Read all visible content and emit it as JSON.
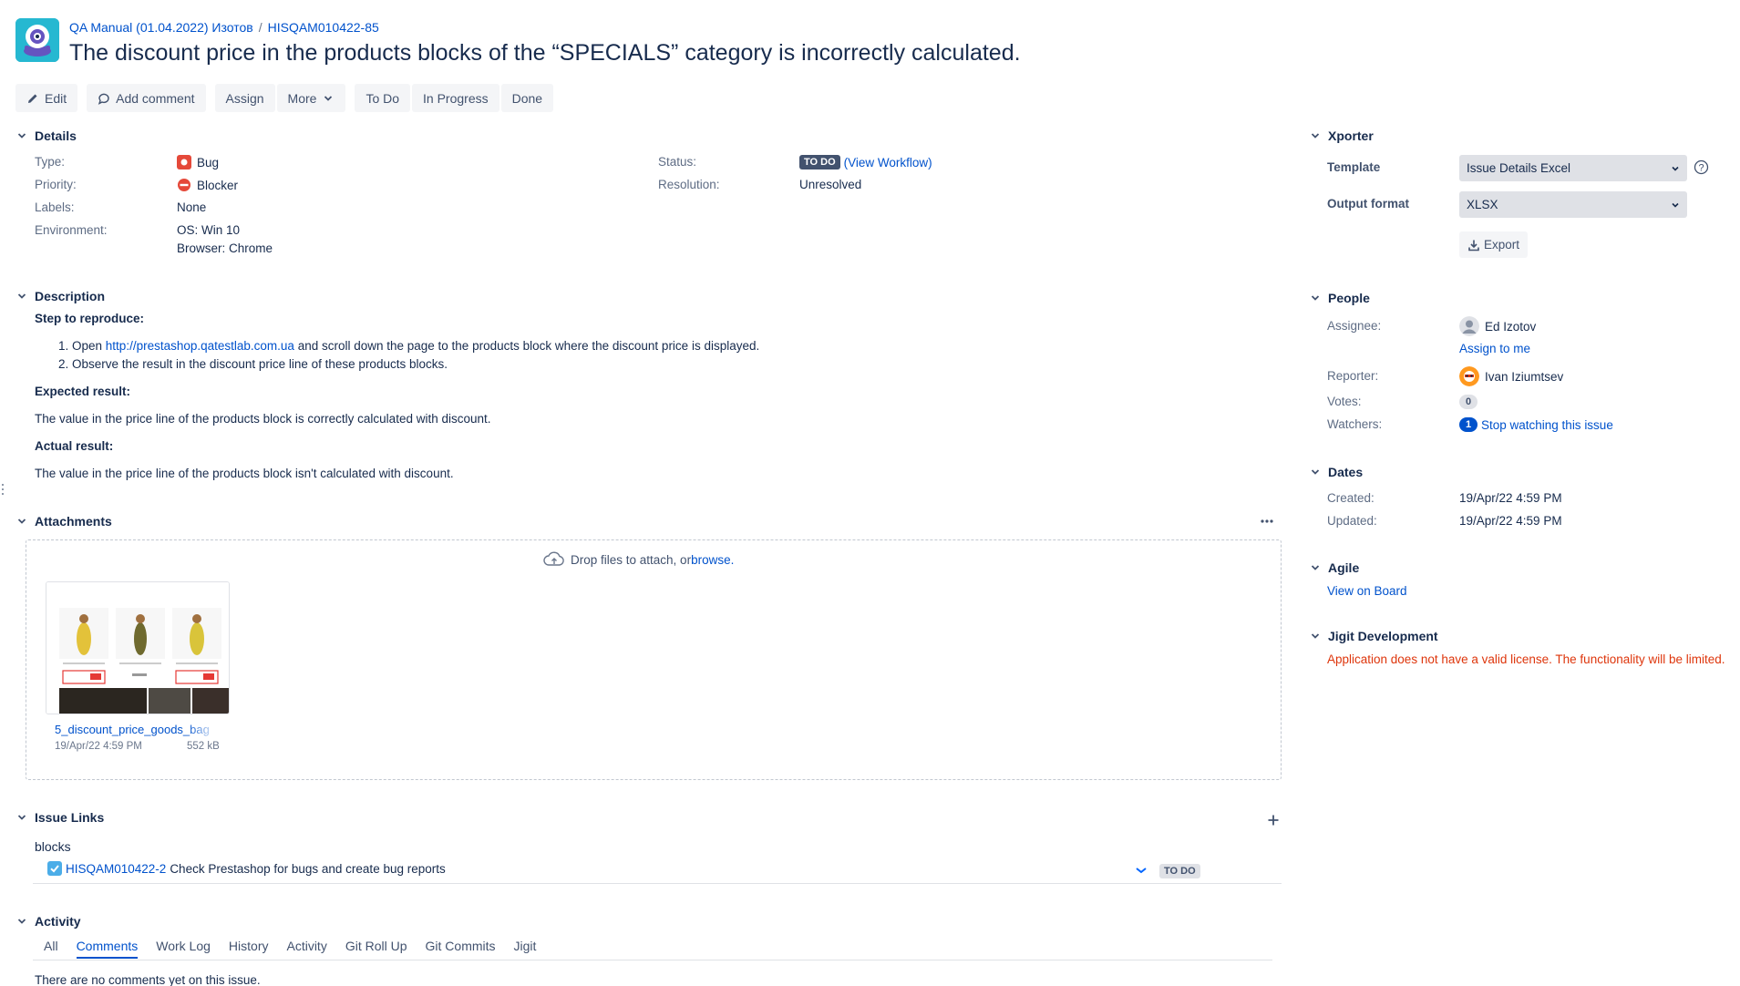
{
  "header": {
    "project_link": "QA Manual (01.04.2022) Изотов",
    "issue_key": "HISQAM010422-85",
    "title": "The discount price in the products blocks of the “SPECIALS” category is incorrectly calculated."
  },
  "toolbar": {
    "edit": "Edit",
    "add_comment": "Add comment",
    "assign": "Assign",
    "more": "More",
    "todo": "To Do",
    "in_progress": "In Progress",
    "done": "Done"
  },
  "details": {
    "heading": "Details",
    "type_label": "Type:",
    "type_value": "Bug",
    "priority_label": "Priority:",
    "priority_value": "Blocker",
    "labels_label": "Labels:",
    "labels_value": "None",
    "environment_label": "Environment:",
    "environment_line1": "OS: Win 10",
    "environment_line2": "Browser: Chrome",
    "status_label": "Status:",
    "status_value": "TO DO",
    "view_workflow": "(View Workflow)",
    "resolution_label": "Resolution:",
    "resolution_value": "Unresolved"
  },
  "description": {
    "heading": "Description",
    "steps_heading": "Step to reproduce:",
    "step1_prefix": "1. Open ",
    "step1_link": "http://prestashop.qatestlab.com.ua",
    "step1_suffix": " and scroll down the page to the products block where the discount price is displayed.",
    "step2": "2. Observe the result in the discount price line of these products blocks.",
    "expected_heading": "Expected result:",
    "expected_text": "The value in the price line of the products block is correctly calculated with discount.",
    "actual_heading": "Actual result:",
    "actual_text": "The value in the price line of the products block isn't calculated with discount."
  },
  "attachments": {
    "heading": "Attachments",
    "drop_text": "Drop files to attach, or ",
    "browse": "browse.",
    "file": {
      "name": "5_discount_price_goods_bag",
      "date": "19/Apr/22 4:59 PM",
      "size": "552 kB"
    }
  },
  "issue_links": {
    "heading": "Issue Links",
    "relation": "blocks",
    "linked_key": "HISQAM010422-2",
    "linked_summary": "Check Prestashop for bugs and create bug reports",
    "linked_status": "TO DO"
  },
  "activity": {
    "heading": "Activity",
    "tabs": [
      "All",
      "Comments",
      "Work Log",
      "History",
      "Activity",
      "Git Roll Up",
      "Git Commits",
      "Jigit"
    ],
    "active_tab": "Comments",
    "empty_text": "There are no comments yet on this issue."
  },
  "xporter": {
    "heading": "Xporter",
    "template_label": "Template",
    "template_value": "Issue Details Excel",
    "output_label": "Output format",
    "output_value": "XLSX",
    "export_button": "Export"
  },
  "people": {
    "heading": "People",
    "assignee_label": "Assignee:",
    "assignee_value": "Ed Izotov",
    "assign_to_me": "Assign to me",
    "reporter_label": "Reporter:",
    "reporter_value": "Ivan Iziumtsev",
    "votes_label": "Votes:",
    "votes_value": "0",
    "watchers_label": "Watchers:",
    "watchers_count": "1",
    "watchers_action": "Stop watching this issue"
  },
  "dates": {
    "heading": "Dates",
    "created_label": "Created:",
    "created_value": "19/Apr/22 4:59 PM",
    "updated_label": "Updated:",
    "updated_value": "19/Apr/22 4:59 PM"
  },
  "agile": {
    "heading": "Agile",
    "view_on_board": "View on Board"
  },
  "jigit": {
    "heading": "Jigit Development",
    "warning": "Application does not have a valid license. The functionality will be limited."
  },
  "colors": {
    "link": "#0052cc",
    "bug": "#e5493a",
    "blocker": "#e5493a",
    "error": "#de350b",
    "status_dark": "#42526e"
  }
}
